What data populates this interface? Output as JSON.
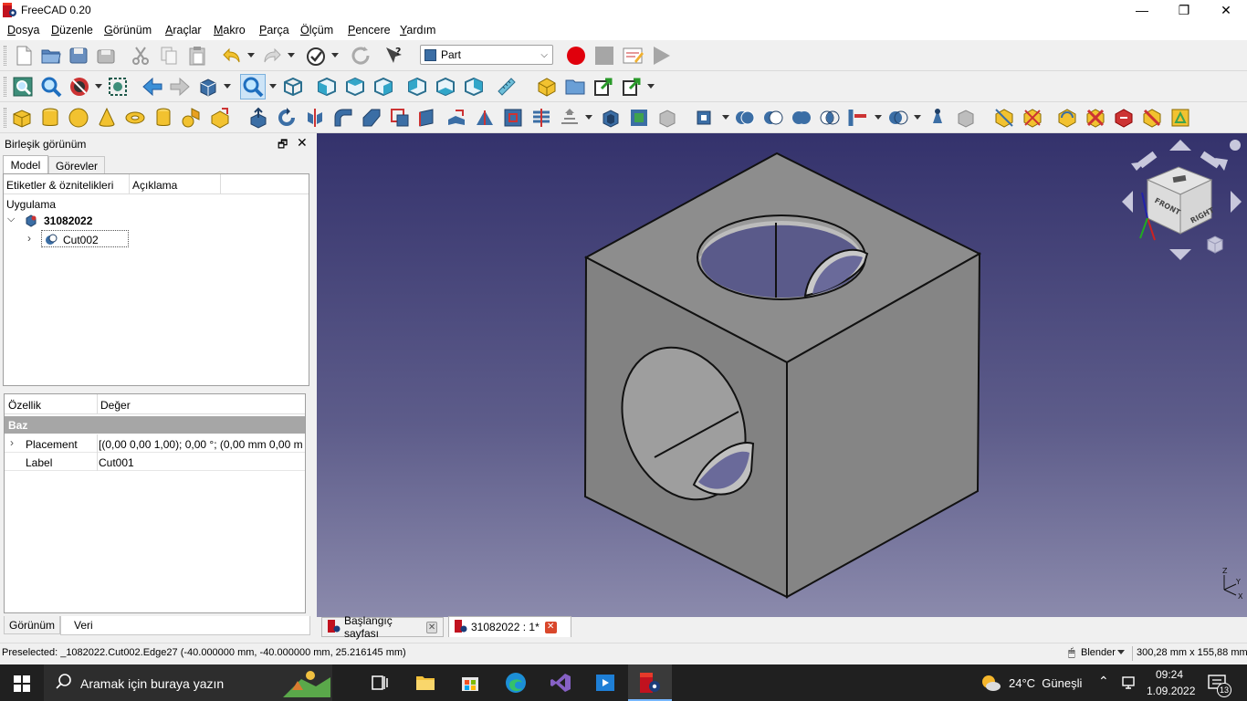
{
  "window": {
    "title": "FreeCAD 0.20",
    "minimize": "—",
    "maximize": "❐",
    "close": "✕"
  },
  "menu": [
    "Dosya",
    "Düzenle",
    "Görünüm",
    "Araçlar",
    "Makro",
    "Parça",
    "Ölçüm",
    "Pencere",
    "Yardım"
  ],
  "workbench": {
    "selected": "Part"
  },
  "combo_view": {
    "title": "Birleşik görünüm",
    "tabs": [
      "Model",
      "Görevler"
    ],
    "tree_columns": [
      "Etiketler & öznitelikleri",
      "Açıklama"
    ],
    "tree_root": "Uygulama",
    "document": "31082022",
    "object": "Cut002"
  },
  "properties": {
    "columns": [
      "Özellik",
      "Değer"
    ],
    "group": "Baz",
    "rows": [
      {
        "name": "Placement",
        "value": "[(0,00 0,00 1,00); 0,00 °; (0,00 mm  0,00 m..."
      },
      {
        "name": "Label",
        "value": "Cut001"
      }
    ],
    "bottom_tabs": [
      "Görünüm",
      "Veri"
    ]
  },
  "doc_tabs": [
    {
      "label": "Başlangıç sayfası"
    },
    {
      "label": "31082022 : 1*"
    }
  ],
  "navcube": {
    "front": "FRONT",
    "right": "RIGHT"
  },
  "axes": {
    "z": "Z",
    "y": "Y",
    "x": "X"
  },
  "status": {
    "preselected": "Preselected: _1082022.Cut002.Edge27 (-40.000000 mm, -40.000000 mm, 25.216145 mm)",
    "nav_style": "Blender",
    "dimensions": "300,28 mm x 155,88 mm"
  },
  "taskbar": {
    "search_placeholder": "Aramak için buraya yazın",
    "weather": "24°C  Güneşli",
    "time": "09:24",
    "date": "1.09.2022",
    "notifications": "13"
  },
  "colors": {
    "viewport_top": "#34326c",
    "viewport_bottom": "#8b8aac",
    "solid_gray": "#8a8a8a",
    "record_red": "#e0000c",
    "taskbar": "#202020"
  }
}
